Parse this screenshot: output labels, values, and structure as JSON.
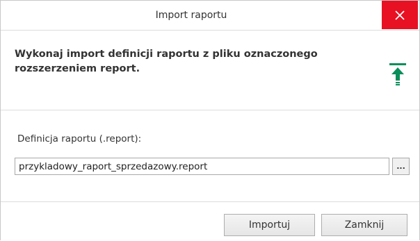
{
  "dialog": {
    "title": "Import raportu",
    "close_glyph": "✕",
    "description": "Wykonaj import definicji raportu z pliku oznaczonego rozszerzeniem report.",
    "icon": "upload-icon",
    "field_label": "Definicja raportu (.report):",
    "file_value": "przykladowy_raport_sprzedazowy.report",
    "browse_label": "...",
    "import_label": "Importuj",
    "close_label": "Zamknij"
  },
  "colors": {
    "close_button": "#e81123",
    "icon_accent": "#0a8f5a"
  }
}
